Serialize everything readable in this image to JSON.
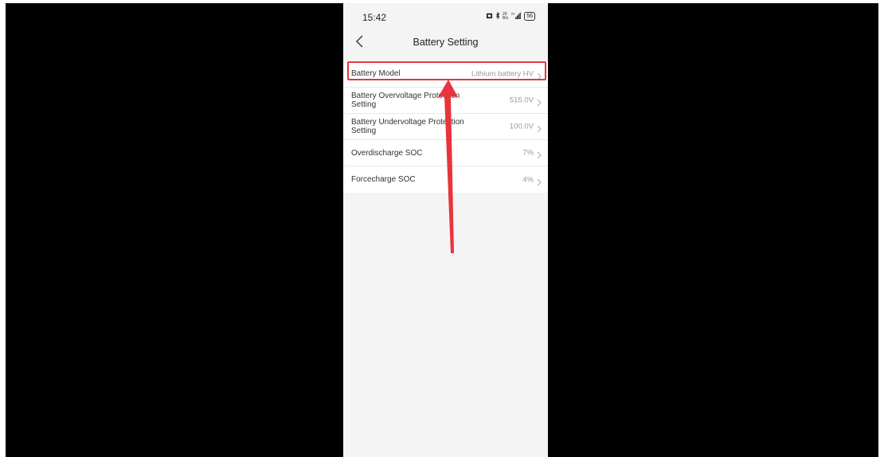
{
  "status_bar": {
    "time": "15:42",
    "icons": [
      "alarm-icon",
      "bluetooth-icon",
      "data-speed-icon",
      "signal-icon",
      "battery-icon"
    ],
    "speed": "20\nB/s",
    "network": "5G",
    "battery": "56"
  },
  "header": {
    "title": "Battery Setting",
    "back_icon": "chevron-left-icon"
  },
  "settings": [
    {
      "label": "Battery Model",
      "value": "Lithium battery HV"
    },
    {
      "label": "Battery Overvoltage Protection Setting",
      "value": "515.0V"
    },
    {
      "label": "Battery Undervoltage Protection Setting",
      "value": "100.0V"
    },
    {
      "label": "Overdischarge SOC",
      "value": "7%"
    },
    {
      "label": "Forcecharge SOC",
      "value": "4%"
    }
  ],
  "annotation": {
    "highlight_color": "#e8343c",
    "arrow_color": "#e8343c"
  },
  "colors": {
    "background": "#f4f4f4",
    "list_bg": "#ffffff",
    "value_text": "#999999"
  }
}
